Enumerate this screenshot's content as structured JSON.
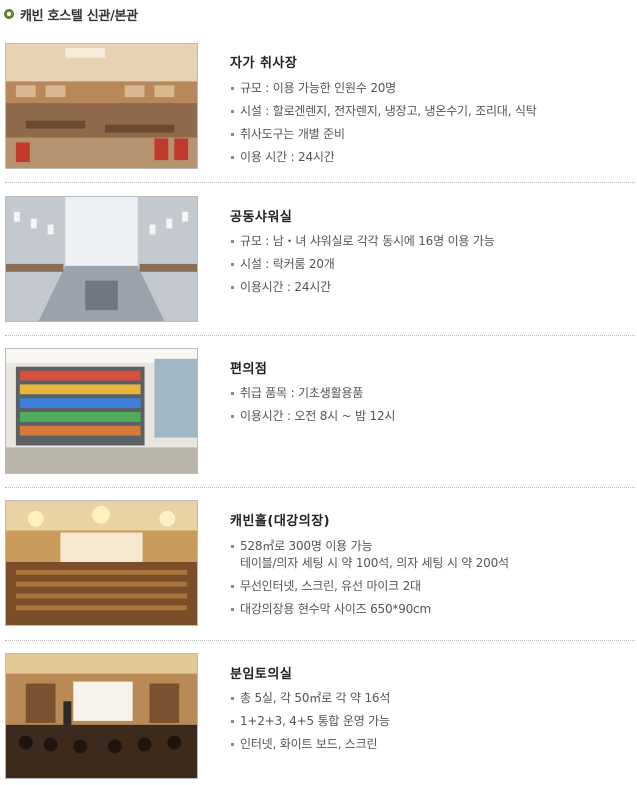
{
  "header": {
    "title": "캐빈 호스텔 신관/본관",
    "bullet_color": "#6a8f2c"
  },
  "sections": [
    {
      "name": "자가 취사장",
      "image": "kitchen-photo",
      "items": [
        {
          "text": "규모 : 이용 가능한 인원수 20명"
        },
        {
          "text": "시설 : 할로겐렌지, 전자렌지, 냉장고, 냉온수기, 조리대, 식탁"
        },
        {
          "text": "취사도구는 개별 준비"
        },
        {
          "text": "이용 시간 : 24시간"
        }
      ]
    },
    {
      "name": "공동샤워실",
      "image": "shower-room-photo",
      "items": [
        {
          "text": "규모 : 남・녀 샤워실로 각각 동시에 16명 이용 가능"
        },
        {
          "text": "시설 : 락커룸 20개"
        },
        {
          "text": "이용시간 : 24시간"
        }
      ]
    },
    {
      "name": "편의점",
      "image": "convenience-store-photo",
      "items": [
        {
          "text": "취급 품목 : 기초생활용품"
        },
        {
          "text": "이용시간 : 오전 8시 ~ 밤 12시"
        }
      ]
    },
    {
      "name": "캐빈홀(대강의장)",
      "image": "cabin-hall-photo",
      "items": [
        {
          "text": "528㎡로 300명 이용 가능",
          "text2": "테이블/의자 세팅 시 약 100석, 의자 세팅 시 약 200석"
        },
        {
          "text": "무선인터넷, 스크린, 유선 마이크 2대"
        },
        {
          "text": "대강의장용 현수막 사이즈 650*90cm"
        }
      ]
    },
    {
      "name": "분임토의실",
      "image": "seminar-room-photo",
      "items": [
        {
          "text": "총 5실, 각 50㎡로 각 약 16석"
        },
        {
          "text": "1+2+3, 4+5 통합 운영 가능"
        },
        {
          "text": "인터넷, 화이트 보드, 스크린"
        }
      ]
    }
  ]
}
